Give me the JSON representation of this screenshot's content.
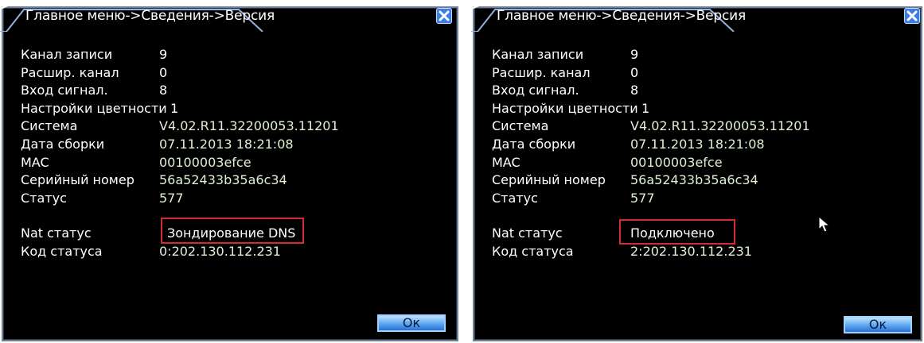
{
  "windows": [
    {
      "title": "Главное меню->Сведения->Версия",
      "rows": [
        {
          "label": "Канал записи",
          "value": "9"
        },
        {
          "label": "Расшир. канал",
          "value": "0"
        },
        {
          "label": "Вход сигнал.",
          "value": "8"
        },
        {
          "label": "Настройки цветности",
          "value": "1"
        },
        {
          "label": "Система",
          "value": "V4.02.R11.32200053.11201"
        },
        {
          "label": "Дата сборки",
          "value": "07.11.2013 18:21:08"
        },
        {
          "label": "MAC",
          "value": "00100003efce"
        },
        {
          "label": "Серийный номер",
          "value": "56a52433b35a6c34"
        },
        {
          "label": "Статус",
          "value": "577"
        }
      ],
      "nat": {
        "label": "Nat статус",
        "value": "Зондирование DNS"
      },
      "code": {
        "label": "Код статуса",
        "value": "0:202.130.112.231"
      },
      "ok_label": "Ок"
    },
    {
      "title": "Главное меню->Сведения->Версия",
      "rows": [
        {
          "label": "Канал записи",
          "value": "9"
        },
        {
          "label": "Расшир. канал",
          "value": "0"
        },
        {
          "label": "Вход сигнал.",
          "value": "8"
        },
        {
          "label": "Настройки цветности",
          "value": "1"
        },
        {
          "label": "Система",
          "value": "V4.02.R11.32200053.11201"
        },
        {
          "label": "Дата сборки",
          "value": "07.11.2013 18:21:08"
        },
        {
          "label": "MAC",
          "value": "00100003efce"
        },
        {
          "label": "Серийный номер",
          "value": "56a52433b35a6c34"
        },
        {
          "label": "Статус",
          "value": "577"
        }
      ],
      "nat": {
        "label": "Nat статус",
        "value": "Подключено"
      },
      "code": {
        "label": "Код статуса",
        "value": "2:202.130.112.231"
      },
      "ok_label": "Ок"
    }
  ],
  "colors": {
    "background": "#000000",
    "frame": "#6f7f95",
    "highlight_box": "#d42a32",
    "close_button": "#3a7ee6",
    "ok_button": "#5aa7f0"
  },
  "icons": [
    "menu-icon",
    "close-icon",
    "mouse-cursor-icon"
  ]
}
